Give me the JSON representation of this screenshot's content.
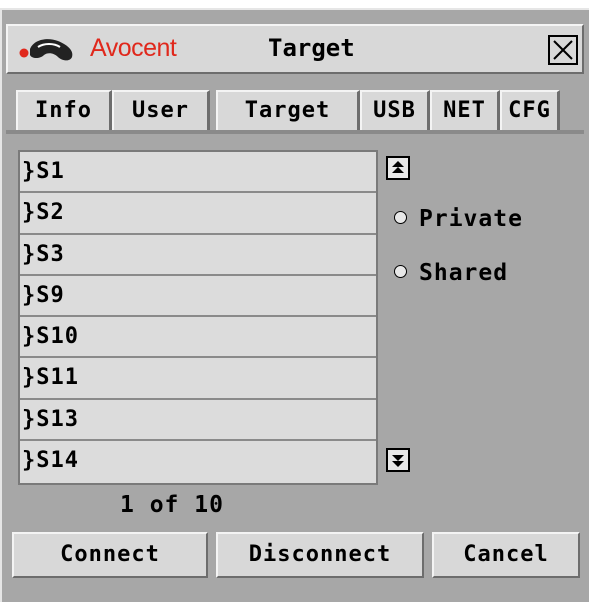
{
  "window": {
    "brand": "Avocent",
    "title": "Target"
  },
  "tabs": [
    {
      "label": "Info"
    },
    {
      "label": "User"
    },
    {
      "label": "Target"
    },
    {
      "label": "USB"
    },
    {
      "label": "NET"
    },
    {
      "label": "CFG"
    }
  ],
  "list": {
    "items": [
      "}S1",
      "}S2",
      "}S3",
      "}S9",
      "}S10",
      "}S11",
      "}S13",
      "}S14"
    ]
  },
  "options": {
    "private_label": "Private",
    "shared_label": "Shared"
  },
  "pager": {
    "text": "1 of 10"
  },
  "buttons": {
    "connect": "Connect",
    "disconnect": "Disconnect",
    "cancel": "Cancel"
  },
  "colors": {
    "brand": "#e0281c",
    "background": "#a7a7a7",
    "control": "#d8d8d8"
  },
  "icons": {
    "logo": "avocent-logo-icon",
    "close": "close-icon",
    "scroll_up": "scroll-up-icon",
    "scroll_down": "scroll-down-icon"
  }
}
